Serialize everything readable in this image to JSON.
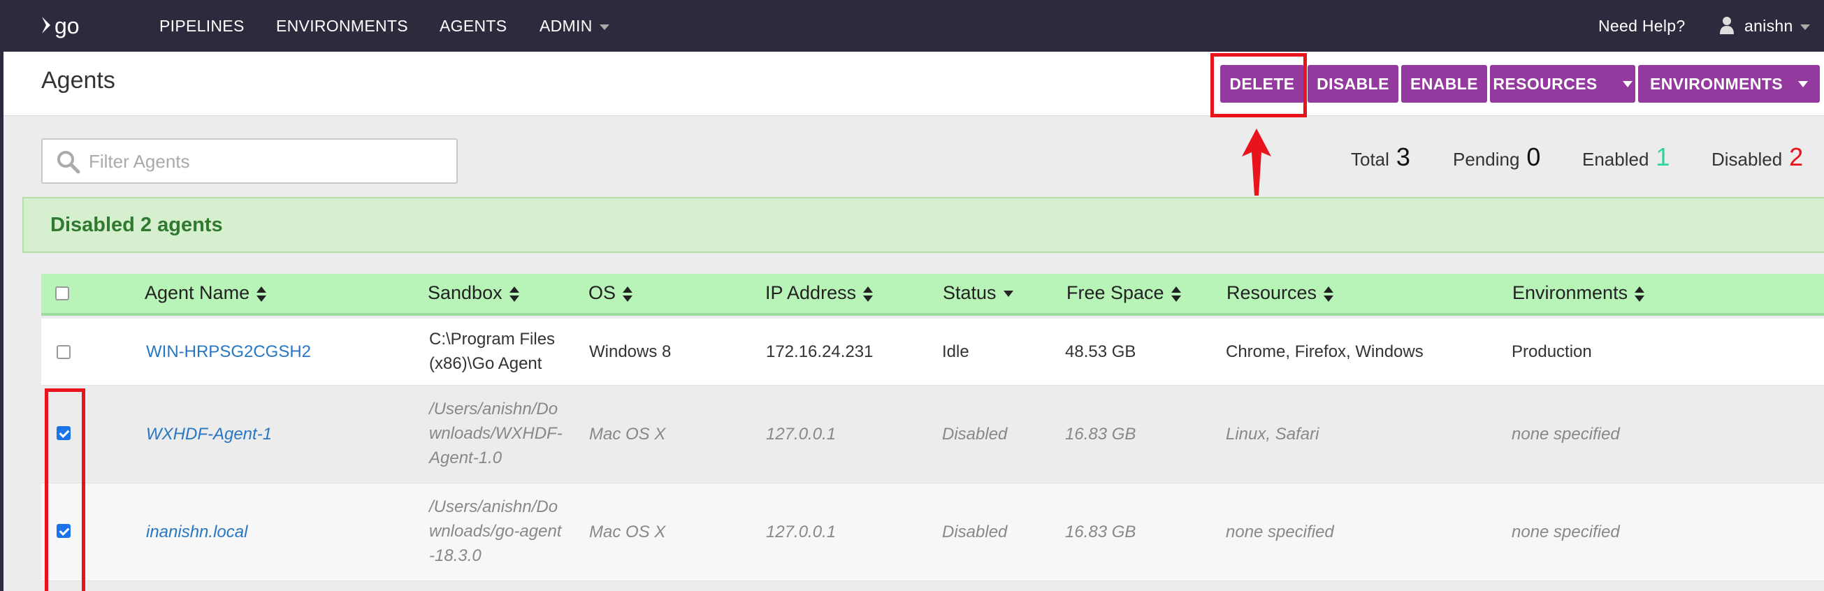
{
  "nav": {
    "logo_text": "go",
    "items": [
      "PIPELINES",
      "ENVIRONMENTS",
      "AGENTS",
      "ADMIN"
    ],
    "help": "Need Help?",
    "user": "anishn"
  },
  "header": {
    "title": "Agents",
    "buttons": {
      "delete": "DELETE",
      "disable": "DISABLE",
      "enable": "ENABLE",
      "resources": "RESOURCES",
      "environments": "ENVIRONMENTS"
    }
  },
  "filter": {
    "placeholder": "Filter Agents",
    "value": ""
  },
  "stats": {
    "total_label": "Total",
    "total": "3",
    "pending_label": "Pending",
    "pending": "0",
    "enabled_label": "Enabled",
    "enabled": "1",
    "disabled_label": "Disabled",
    "disabled": "2"
  },
  "colors": {
    "enabled": "#2fd49a",
    "disabled": "#e8131b",
    "brand": "#943a9e",
    "annotation": "#e8131b"
  },
  "flash": "Disabled 2 agents",
  "table": {
    "columns": [
      "Agent Name",
      "Sandbox",
      "OS",
      "IP Address",
      "Status",
      "Free Space",
      "Resources",
      "Environments"
    ],
    "rows": [
      {
        "checked": false,
        "name": "WIN-HRPSG2CGSH2",
        "sandbox": [
          "C:\\Program Files",
          "(x86)\\Go Agent"
        ],
        "os": "Windows 8",
        "ip": "172.16.24.231",
        "status": "Idle",
        "free_space": "48.53 GB",
        "resources": "Chrome, Firefox, Windows",
        "environments": "Production"
      },
      {
        "checked": true,
        "name": "WXHDF-Agent-1",
        "sandbox": [
          "/Users/anishn/Do",
          "wnloads/WXHDF-",
          "Agent-1.0"
        ],
        "os": "Mac OS X",
        "ip": "127.0.0.1",
        "status": "Disabled",
        "free_space": "16.83 GB",
        "resources": "Linux, Safari",
        "environments": "none specified"
      },
      {
        "checked": true,
        "name": "inanishn.local",
        "sandbox": [
          "/Users/anishn/Do",
          "wnloads/go-agent",
          "-18.3.0"
        ],
        "os": "Mac OS X",
        "ip": "127.0.0.1",
        "status": "Disabled",
        "free_space": "16.83 GB",
        "resources": "none specified",
        "environments": "none specified"
      }
    ]
  }
}
